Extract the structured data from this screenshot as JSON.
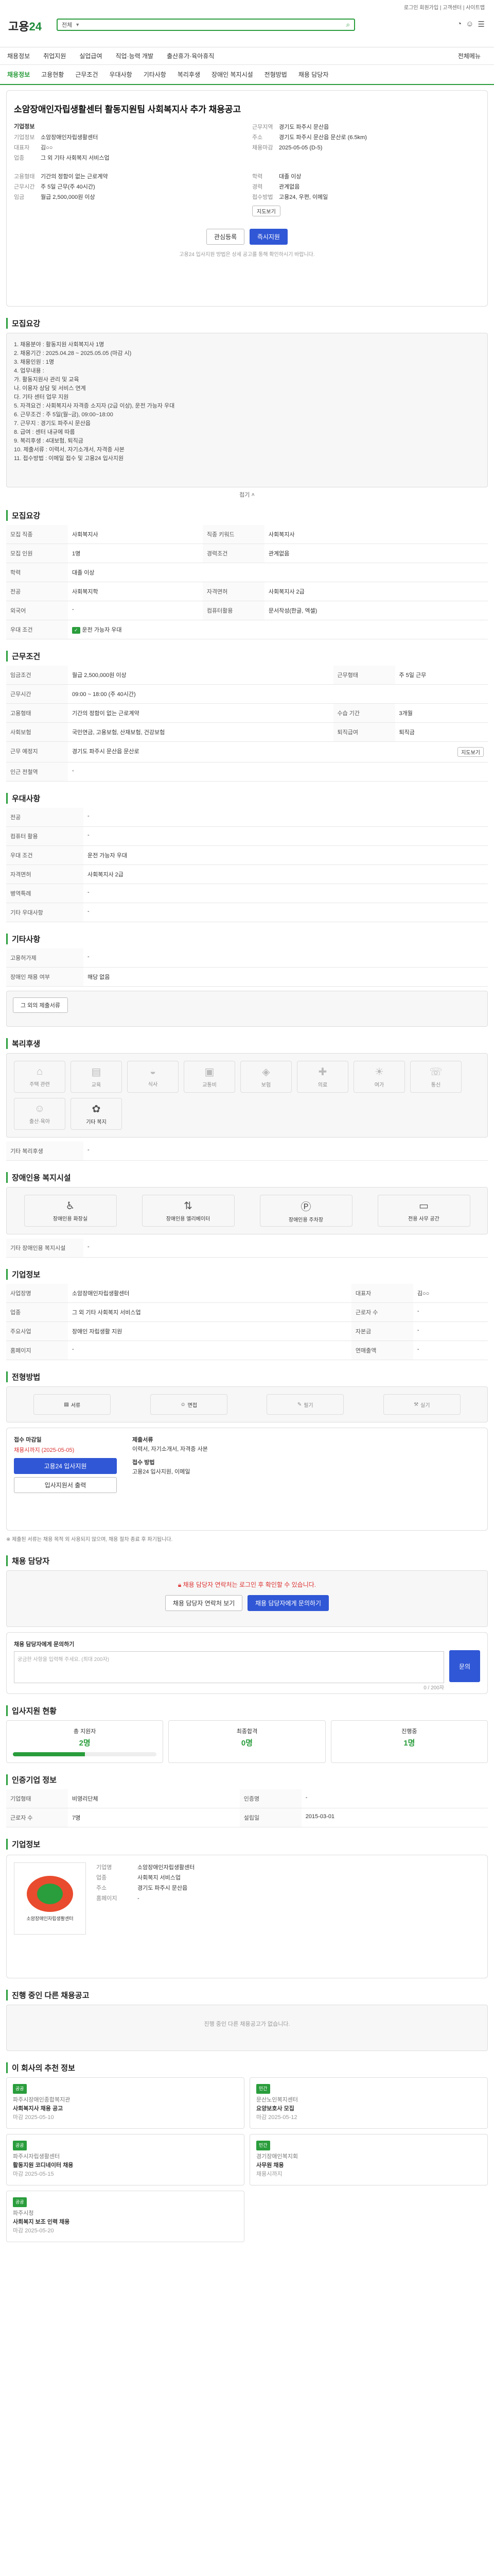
{
  "header": {
    "logo_a": "고용",
    "logo_b": "24",
    "search_scope": "전체",
    "toplinks": "로그인 회원가입 | 고객센터 | 사이트맵",
    "nav": [
      "채용정보",
      "취업지원",
      "실업급여",
      "직업·능력 개발",
      "출산휴가·육아휴직"
    ],
    "nav_right": "전체메뉴",
    "breadcrumb": "채용정보"
  },
  "tabs": [
    "채용정보",
    "고용현황",
    "근무조건",
    "우대사항",
    "기타사항",
    "복리후생",
    "장애인 복지시설",
    "전형방법",
    "채용 담당자"
  ],
  "job": {
    "title": "소암장애인자립생활센터 활동지원팀 사회복지사 추가 채용공고",
    "company_label": "기업정보",
    "company": "소암장애인자립생활센터",
    "rep_label": "대표자",
    "rep": "김○○",
    "industry_label": "업종",
    "industry": "그 외 기타 사회복지 서비스업",
    "area_label": "근무지역",
    "area": "경기도 파주시 문산읍",
    "addr_label": "주소",
    "addr": "경기도 파주시 문산읍 문산로 (6.5km)",
    "map": "지도보기",
    "deadline_label": "채용마감",
    "deadline": "2025-05-05 (D-5)",
    "apply": "즉시지원",
    "like": "관심등록",
    "recv_label": "접수방법",
    "recv": "고용24, 우편, 이메일",
    "wage_label": "임금",
    "wage": "월급 2,500,000원 이상",
    "type_label": "고용형태",
    "type": "기간의 정함이 없는 근로계약",
    "hours_label": "근무시간",
    "hours": "주 5일 근무(주 40시간)",
    "edu_label": "학력",
    "edu": "대졸 이상",
    "career_label": "경력",
    "career": "관계없음",
    "note": "고용24 입사지원 방법은 상세 공고를 통해 확인하시기 바랍니다."
  },
  "summary": {
    "title": "모집요강",
    "text": "1. 채용분야 : 활동지원 사회복지사 1명\n2. 채용기간 : 2025.04.28 ~ 2025.05.05 (마감 시)\n3. 채용인원 : 1명\n4. 업무내용 :\n  가. 활동지원사 관리 및 교육\n  나. 이용자 상담 및 서비스 연계\n  다. 기타 센터 업무 지원\n5. 자격요건 : 사회복지사 자격증 소지자 (2급 이상), 운전 가능자 우대\n6. 근무조건 : 주 5일(월~금), 09:00~18:00\n7. 근무지 : 경기도 파주시 문산읍\n8. 급여 : 센터 내규에 따름\n9. 복리후생 : 4대보험, 퇴직금\n10. 제출서류 : 이력서, 자기소개서, 자격증 사본\n11. 접수방법 : 이메일 접수 및 고용24 입사지원",
    "more": "접기"
  },
  "recruit": {
    "title": "모집요강",
    "rows": [
      [
        "모집 직종",
        "사회복지사",
        "직종 키워드",
        "사회복지사"
      ],
      [
        "모집 인원",
        "1명",
        "경력조건",
        "관계없음"
      ],
      [
        "학력",
        "대졸 이상",
        "",
        ""
      ],
      [
        "전공",
        "사회복지학",
        "자격면허",
        "사회복지사 2급"
      ],
      [
        "외국어",
        "-",
        "컴퓨터활용",
        "문서작성(한글, 엑셀)"
      ],
      [
        "우대 조건",
        "운전 가능자 우대",
        "",
        ""
      ]
    ]
  },
  "work": {
    "title": "근무조건",
    "wage_k": "임금조건",
    "wage": "월급 2,500,000원 이상",
    "hours_k": "근무시간",
    "hours": "09:00 ~ 18:00 (주 40시간)",
    "contract_k": "고용형태",
    "contract": "기간의 정함이 없는 근로계약",
    "days_k": "근무형태",
    "days": "주 5일 근무",
    "insure_k": "사회보험",
    "insure": "국민연금, 고용보험, 산재보험, 건강보험",
    "retire_k": "퇴직급여",
    "retire": "퇴직금",
    "place_k": "근무 예정지",
    "place": "경기도 파주시 문산읍 문산로",
    "near_k": "인근 전철역",
    "near": "-",
    "trial_k": "수습 기간",
    "trial": "3개월"
  },
  "pref": {
    "title": "우대사항",
    "rows": [
      [
        "전공",
        "-"
      ],
      [
        "컴퓨터 활용",
        "-"
      ],
      [
        "우대 조건",
        "운전 가능자 우대"
      ],
      [
        "자격면허",
        "사회복지사 2급"
      ],
      [
        "병역특례",
        "-"
      ],
      [
        "기타 우대사항",
        "-"
      ]
    ]
  },
  "etc": {
    "title": "기타사항",
    "rows": [
      [
        "고용허가제",
        "-"
      ],
      [
        "장애인 채용 여부",
        "해당 없음"
      ]
    ],
    "btn": "그 외의 제출서류"
  },
  "welfare": {
    "title": "복리후생",
    "items": [
      "주택 관련",
      "교육",
      "식사",
      "교통비",
      "보험",
      "의료",
      "여가",
      "통신",
      "출산·육아",
      "기타 복지"
    ],
    "on_index": 9,
    "other_k": "기타 복리후생",
    "other": "-"
  },
  "disab": {
    "title": "장애인용 복지시설",
    "items": [
      "장애인용 화장실",
      "장애인용 엘리베이터",
      "장애인용 주차장",
      "전용 사무 공간"
    ],
    "other_k": "기타 장애인용 복지시설",
    "other": "-"
  },
  "company": {
    "title": "기업정보",
    "rows": [
      [
        "사업장명",
        "소암장애인자립생활센터",
        "대표자",
        "김○○"
      ],
      [
        "업종",
        "그 외 기타 사회복지 서비스업",
        "근로자 수",
        "-"
      ],
      [
        "주요사업",
        "장애인 자립생활 지원",
        "자본금",
        "-"
      ],
      [
        "홈페이지",
        "-",
        "연매출액",
        "-"
      ]
    ]
  },
  "process": {
    "title": "전형방법",
    "steps": [
      "서류",
      "면접",
      "필기",
      "실기"
    ],
    "apply_k": "접수 마감일",
    "apply_v": "채용시까지 (2025-05-05)",
    "apply_btn": "고용24 입사지원",
    "docs_k": "제출서류",
    "docs_v": "이력서, 자기소개서, 자격증 사본",
    "method_k": "접수 방법",
    "method_v": "고용24 입사지원, 이메일",
    "print_btn": "입사지원서 출력",
    "notice": "※ 제출된 서류는 채용 목적 외 사용되지 않으며, 채용 절차 종료 후 파기됩니다."
  },
  "contact": {
    "title": "채용 담당자",
    "lead": "채용 담당자 연락처는 로그인 후 확인할 수 있습니다.",
    "b1": "채용 담당자 연락처 보기",
    "b2": "채용 담당자에게 문의하기",
    "q_label": "채용 담당자에게 문의하기",
    "q_placeholder": "궁금한 사항을 입력해 주세요. (최대 200자)",
    "q_count": "0 / 200자",
    "send": "문의"
  },
  "stats": {
    "title": "입사지원 현황",
    "items": [
      [
        "총 지원자",
        "2명"
      ],
      [
        "최종합격",
        "0명"
      ],
      [
        "진행중",
        "1명"
      ]
    ],
    "ratio": 0.5
  },
  "info2": {
    "title": "인증기업 정보",
    "rows": [
      [
        "기업형태",
        "비영리단체",
        "인증명",
        "-"
      ],
      [
        "근로자 수",
        "7명",
        "설립일",
        "2015-03-01"
      ]
    ]
  },
  "promo": {
    "title": "기업정보",
    "brand": "소암장애인자립생활센터",
    "rows": [
      [
        "기업명",
        "소암장애인자립생활센터"
      ],
      [
        "업종",
        "사회복지 서비스업"
      ],
      [
        "주소",
        "경기도 파주시 문산읍"
      ],
      [
        "홈페이지",
        "-"
      ]
    ]
  },
  "similar": {
    "title": "진행 중인 다른 채용공고",
    "empty": "진행 중인 다른 채용공고가 없습니다."
  },
  "recs": {
    "title": "이 회사의 추천 정보",
    "items": [
      {
        "tag": "공공",
        "co": "파주시장애인종합복지관",
        "t": "사회복지사 채용 공고",
        "d": "마감 2025-05-10"
      },
      {
        "tag": "민간",
        "co": "문산노인복지센터",
        "t": "요양보호사 모집",
        "d": "마감 2025-05-12"
      },
      {
        "tag": "공공",
        "co": "파주시자립생활센터",
        "t": "활동지원 코디네이터 채용",
        "d": "마감 2025-05-15"
      },
      {
        "tag": "민간",
        "co": "경기장애인복지회",
        "t": "사무원 채용",
        "d": "채용시까지"
      },
      {
        "tag": "공공",
        "co": "파주시청",
        "t": "사회복지 보조 인력 채용",
        "d": "마감 2025-05-20"
      }
    ]
  }
}
